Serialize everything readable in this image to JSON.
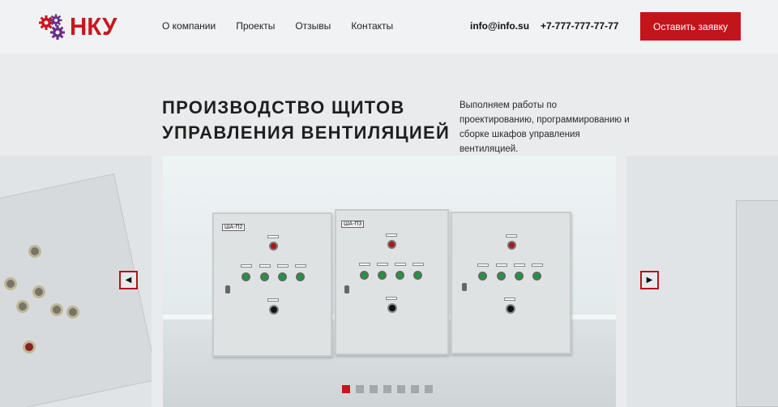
{
  "header": {
    "logo_text": "НКУ",
    "nav": [
      "О компании",
      "Проекты",
      "Отзывы",
      "Контакты"
    ],
    "email": "info@info.su",
    "phone": "+7-777-777-77-77",
    "cta_label": "Оставить заявку"
  },
  "hero": {
    "title_line1": "ПРОИЗВОДСТВО ЩИТОВ",
    "title_line2": "УПРАВЛЕНИЯ ВЕНТИЛЯЦИЕЙ",
    "subtitle": "Выполняем работы по проектированию, программированию и сборке шкафов управления вентиляцией."
  },
  "slider": {
    "cabinet_labels": [
      "ША-П2",
      "ША-П3"
    ],
    "prev_glyph": "◀",
    "next_glyph": "▶",
    "dots_total": 7,
    "active_dot": 0
  },
  "colors": {
    "accent": "#c2141b",
    "background": "#e9ebed"
  }
}
